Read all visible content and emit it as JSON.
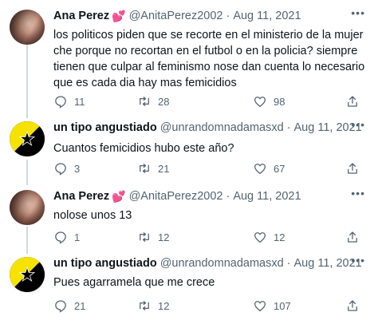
{
  "tweets": [
    {
      "name": "Ana Perez",
      "emoji": "💕",
      "handle": "@AnitaPerez2002",
      "date": "Aug 11, 2021",
      "text": "los politicos piden que se recorte en el ministerio de la mujer che porque no recortan en el futbol o en la policia? siempre tienen que culpar al feminismo nose dan cuenta lo necesario que es cada dia hay mas femicidios",
      "replies": "11",
      "retweets": "28",
      "likes": "98"
    },
    {
      "name": "un tipo angustiado",
      "emoji": "",
      "handle": "@unrandomnadamasxd",
      "date": "Aug 11, 2021",
      "text": "Cuantos femicidios hubo este año?",
      "replies": "3",
      "retweets": "21",
      "likes": "67"
    },
    {
      "name": "Ana Perez",
      "emoji": "💕",
      "handle": "@AnitaPerez2002",
      "date": "Aug 11, 2021",
      "text": "nolose unos 13",
      "replies": "1",
      "retweets": "12",
      "likes": "12"
    },
    {
      "name": "un tipo angustiado",
      "emoji": "",
      "handle": "@unrandomnadamasxd",
      "date": "Aug 11, 2021",
      "text": "Pues agarramela que me crece",
      "replies": "21",
      "retweets": "12",
      "likes": "107"
    }
  ],
  "separator": "·",
  "more_glyph": "•••",
  "colors": {
    "muted": "#536471",
    "text": "#0f1419",
    "thread_line": "#cfd9de",
    "anarchy_yellow": "#f5e200"
  }
}
